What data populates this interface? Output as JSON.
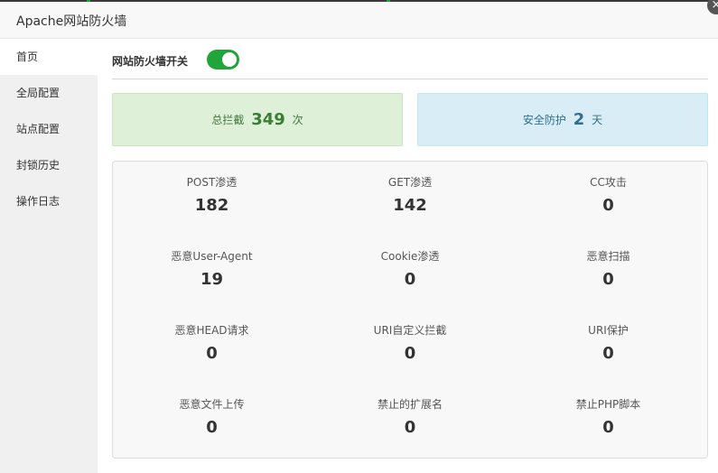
{
  "window": {
    "title": "Apache网站防火墙"
  },
  "sidebar": {
    "items": [
      {
        "label": "首页"
      },
      {
        "label": "全局配置"
      },
      {
        "label": "站点配置"
      },
      {
        "label": "封锁历史"
      },
      {
        "label": "操作日志"
      }
    ],
    "active_index": 0
  },
  "main": {
    "switch_label": "网站防火墙开关",
    "switch_on": true,
    "total_block": {
      "prefix": "总拦截",
      "value": "349",
      "unit": "次"
    },
    "protect_days": {
      "prefix": "安全防护",
      "value": "2",
      "unit": "天"
    },
    "stats": [
      {
        "label": "POST渗透",
        "value": "182"
      },
      {
        "label": "GET渗透",
        "value": "142"
      },
      {
        "label": "CC攻击",
        "value": "0"
      },
      {
        "label": "恶意User-Agent",
        "value": "19"
      },
      {
        "label": "Cookie渗透",
        "value": "0"
      },
      {
        "label": "恶意扫描",
        "value": "0"
      },
      {
        "label": "恶意HEAD请求",
        "value": "0"
      },
      {
        "label": "URI自定义拦截",
        "value": "0"
      },
      {
        "label": "URI保护",
        "value": "0"
      },
      {
        "label": "恶意文件上传",
        "value": "0"
      },
      {
        "label": "禁止的扩展名",
        "value": "0"
      },
      {
        "label": "禁止PHP脚本",
        "value": "0"
      }
    ]
  },
  "colors": {
    "accent_green": "#20a53a",
    "success_bg": "#dff0d8",
    "info_bg": "#d9edf7"
  },
  "icons": {
    "close": "close-icon"
  }
}
